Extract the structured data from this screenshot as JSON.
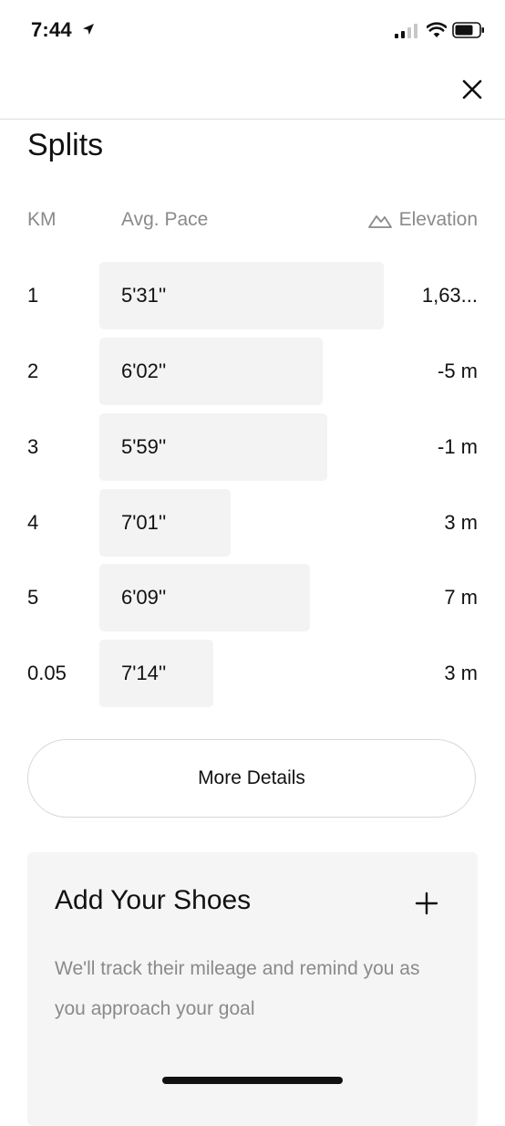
{
  "status_bar": {
    "time": "7:44"
  },
  "page": {
    "title": "Splits"
  },
  "columns": {
    "km": "KM",
    "pace": "Avg. Pace",
    "elevation": "Elevation"
  },
  "splits": [
    {
      "km": "1",
      "pace": "5'31''",
      "elevation": "1,63...",
      "bar_fraction": 1.0
    },
    {
      "km": "2",
      "pace": "6'02''",
      "elevation": "-5 m",
      "bar_fraction": 0.785
    },
    {
      "km": "3",
      "pace": "5'59''",
      "elevation": "-1 m",
      "bar_fraction": 0.8
    },
    {
      "km": "4",
      "pace": "7'01''",
      "elevation": "3 m",
      "bar_fraction": 0.46
    },
    {
      "km": "5",
      "pace": "6'09''",
      "elevation": "7 m",
      "bar_fraction": 0.74
    },
    {
      "km": "0.05",
      "pace": "7'14''",
      "elevation": "3 m",
      "bar_fraction": 0.4
    }
  ],
  "actions": {
    "more_details": "More Details"
  },
  "shoes": {
    "title": "Add Your Shoes",
    "description": "We'll track their mileage and remind you as you approach your goal"
  },
  "colors": {
    "background": "#ffffff",
    "text": "#111111",
    "muted": "#8a8a8a",
    "bar": "#f3f3f3",
    "card": "#f5f5f5"
  },
  "icons": {
    "location": "location-arrow-icon",
    "signal": "cellular-signal-icon",
    "wifi": "wifi-icon",
    "battery": "battery-icon",
    "close": "close-icon",
    "elevation": "mountain-icon",
    "add": "plus-icon"
  }
}
